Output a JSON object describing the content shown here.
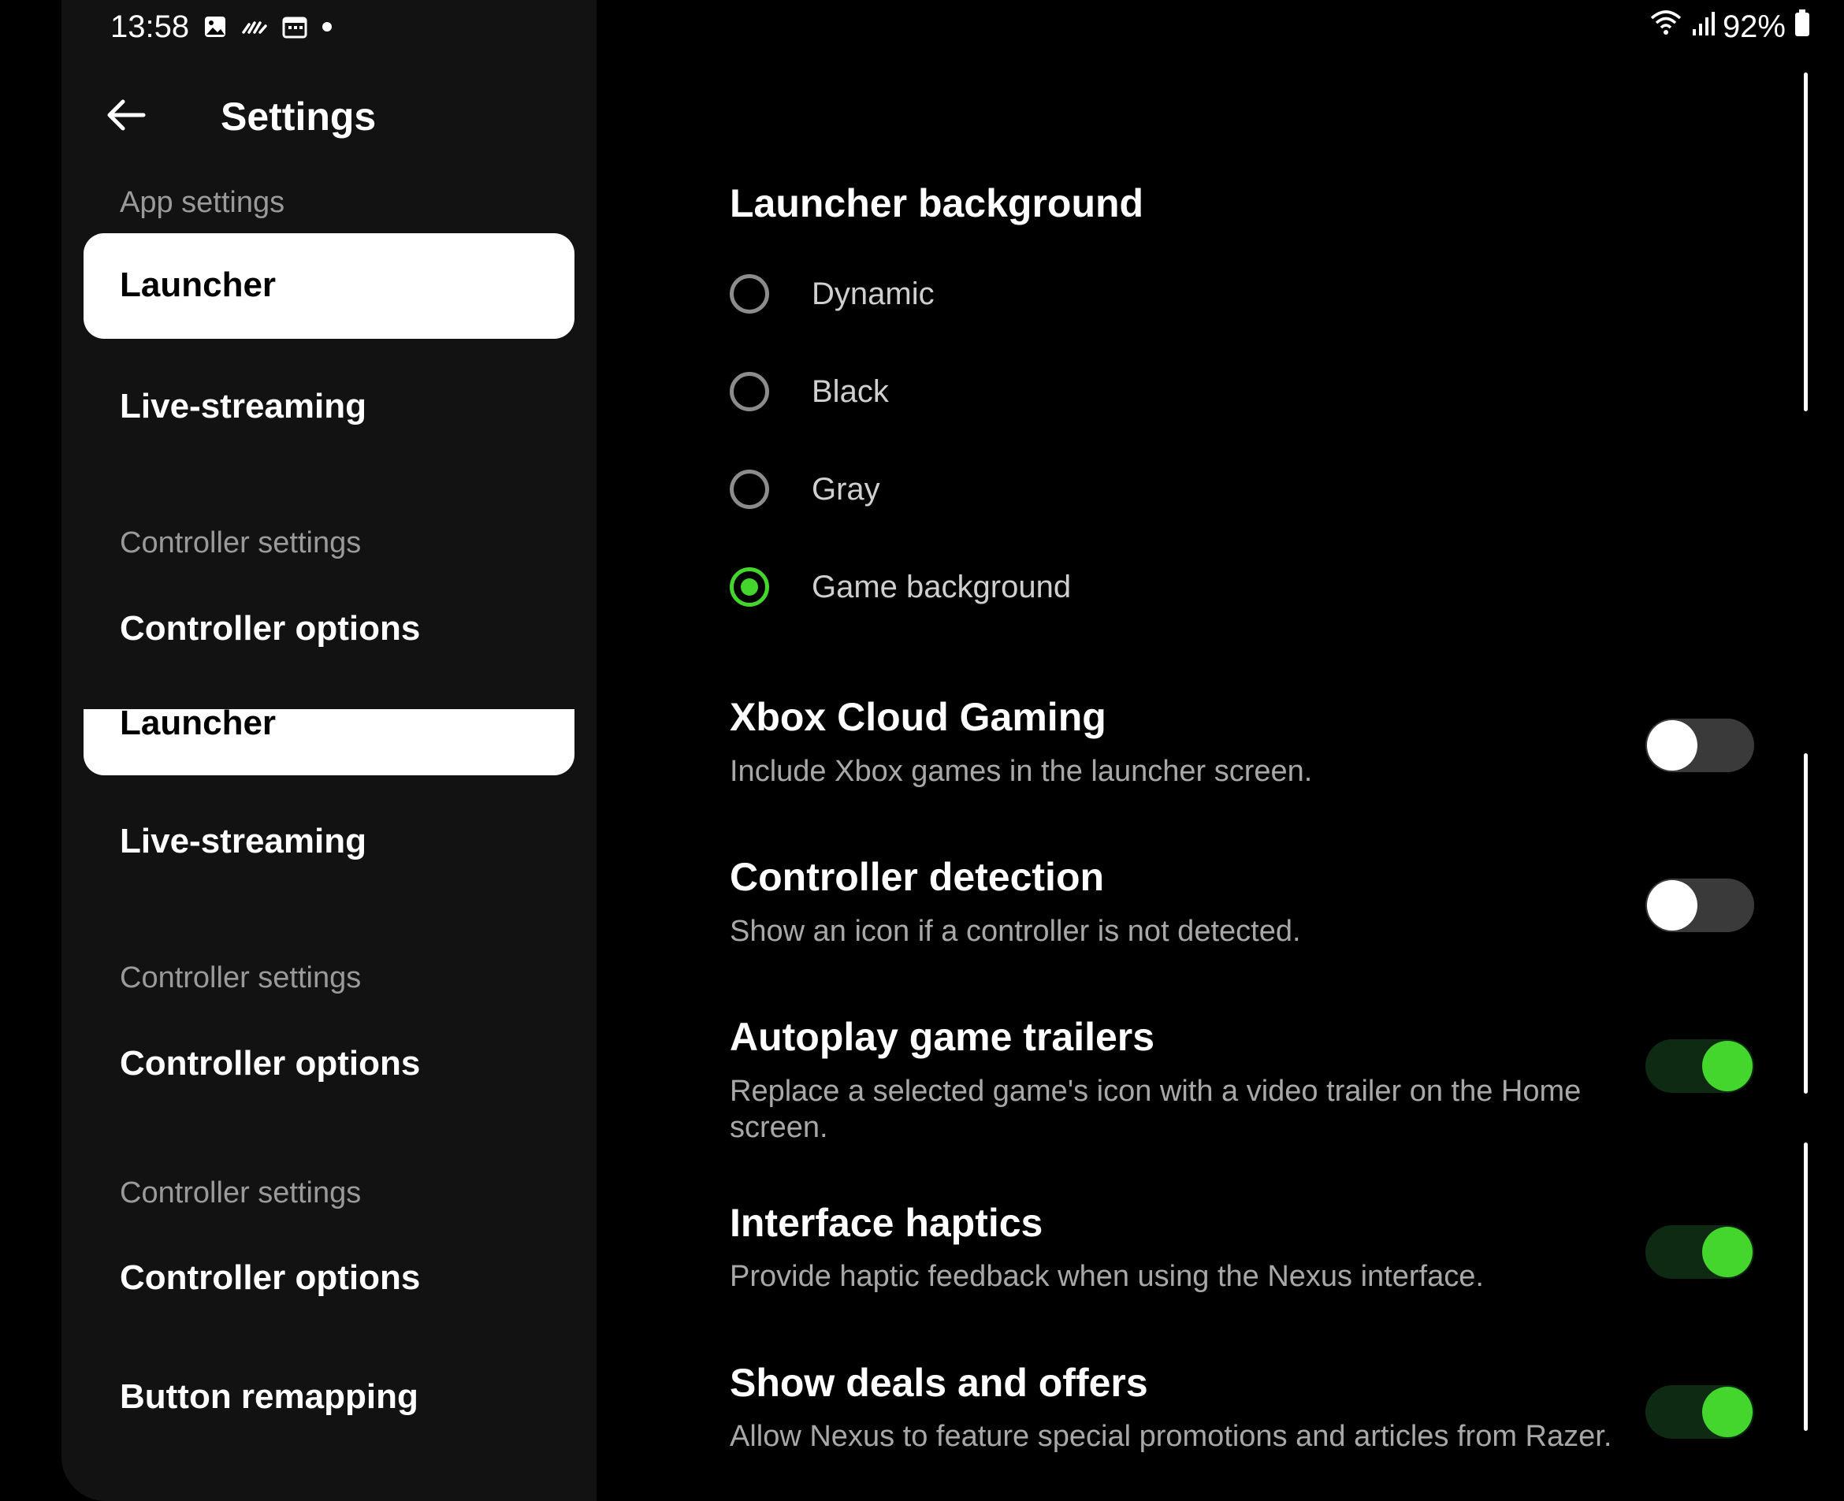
{
  "status_bar": {
    "time": "13:58",
    "left_icons": [
      "image-icon",
      "activity-icon",
      "calendar-icon",
      "dot-icon"
    ],
    "right_icons": [
      "wifi-icon",
      "signal-icon"
    ],
    "battery_percent": "92%"
  },
  "header": {
    "back_icon": "arrow-left-icon",
    "title": "Settings"
  },
  "sidebar": {
    "section_app": "App settings",
    "item_launcher": "Launcher",
    "item_livestreaming": "Live-streaming",
    "section_controller": "Controller settings",
    "item_controller_options": "Controller options",
    "dup_launcher": "Launcher",
    "dup_livestreaming": "Live-streaming",
    "dup_section_controller_1": "Controller settings",
    "dup_controller_options_1": "Controller options",
    "dup_section_controller_2": "Controller settings",
    "dup_controller_options_2": "Controller options",
    "item_button_remapping": "Button remapping"
  },
  "main": {
    "launcher_background": {
      "heading": "Launcher background",
      "options": [
        {
          "label": "Dynamic",
          "selected": false
        },
        {
          "label": "Black",
          "selected": false
        },
        {
          "label": "Gray",
          "selected": false
        },
        {
          "label": "Game background",
          "selected": true
        }
      ]
    },
    "settings": [
      {
        "title": "Xbox Cloud Gaming",
        "description": "Include Xbox games in the launcher screen.",
        "enabled": false
      },
      {
        "title": "Controller detection",
        "description": "Show an icon if a controller is not detected.",
        "enabled": false
      },
      {
        "title": "Autoplay game trailers",
        "description": "Replace a selected game's icon with a video trailer on the Home screen.",
        "enabled": true
      },
      {
        "title": "Interface haptics",
        "description": "Provide haptic feedback when using the Nexus interface.",
        "enabled": true
      },
      {
        "title": "Show deals and offers",
        "description": "Allow Nexus to feature special promotions and articles from Razer.",
        "enabled": true
      }
    ]
  },
  "colors": {
    "accent": "#44d62c",
    "sidebar_bg": "#121212",
    "main_bg": "#000000"
  }
}
